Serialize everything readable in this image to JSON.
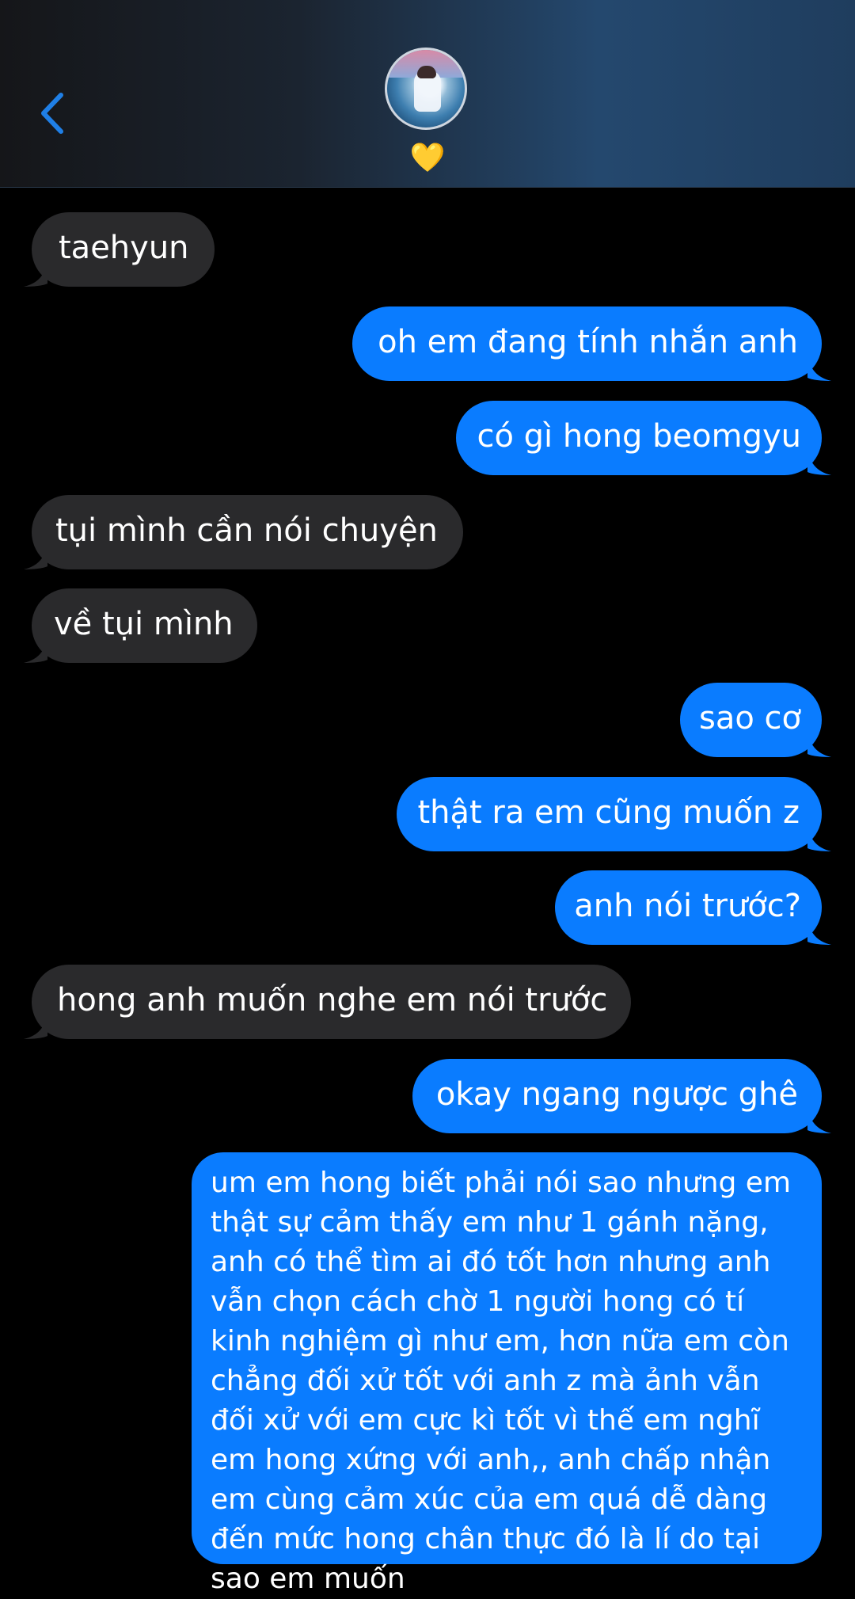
{
  "header": {
    "contact_emoji": "💛",
    "back_icon": "chevron-left-icon",
    "accent_color": "#0a7cff"
  },
  "messages": [
    {
      "side": "in",
      "text": "taehyun"
    },
    {
      "side": "out",
      "text": "oh em đang tính nhắn anh"
    },
    {
      "side": "out",
      "text": "có gì hong beomgyu"
    },
    {
      "side": "in",
      "text": "tụi mình cần nói chuyện"
    },
    {
      "side": "in",
      "text": "về tụi mình"
    },
    {
      "side": "out",
      "text": "sao cơ"
    },
    {
      "side": "out",
      "text": "thật ra em cũng muốn z"
    },
    {
      "side": "out",
      "text": "anh nói trước?"
    },
    {
      "side": "in",
      "text": "hong anh muốn nghe em nói trước"
    },
    {
      "side": "out",
      "text": "okay ngang ngược ghê"
    },
    {
      "side": "out",
      "text": "um em hong biết phải nói sao nhưng em thật sự cảm thấy em như 1 gánh nặng, anh có thể tìm ai đó tốt hơn nhưng anh vẫn chọn cách chờ 1 người hong có tí kinh nghiệm gì như em, hơn nữa em còn chẳng đối xử tốt với anh z mà ảnh vẫn đối xử với em cực kì tốt vì thế em nghĩ em hong xứng với anh,, anh chấp nhận em cùng cảm xúc của em quá dễ dàng đến mức hong chân thực đó là lí do tại sao em muốn"
    }
  ]
}
